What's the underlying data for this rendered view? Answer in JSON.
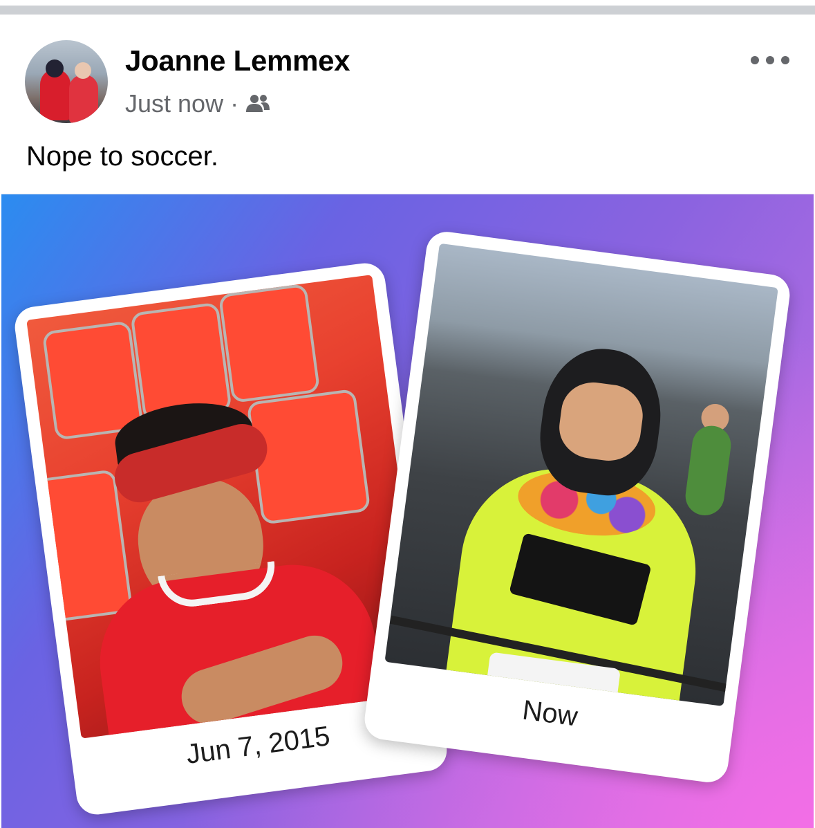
{
  "post": {
    "author_name": "Joanne Lemmex",
    "timestamp": "Just now",
    "separator": "·",
    "audience_icon": "friends-icon",
    "more_icon": "more-horizontal-icon",
    "text": "Nope to soccer."
  },
  "memory": {
    "left_caption": "Jun 7, 2015",
    "right_caption": "Now"
  },
  "colors": {
    "divider": "#cdd0d4",
    "name": "#050505",
    "meta": "#65676b",
    "gradient_start": "#2b8cf0",
    "gradient_mid": "#8b63e0",
    "gradient_end": "#f46ee6"
  }
}
